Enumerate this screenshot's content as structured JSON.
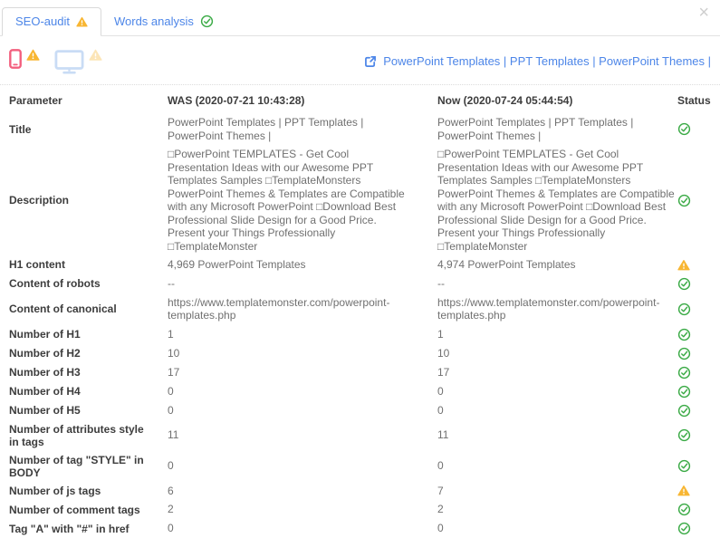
{
  "close_icon": "×",
  "tabs": [
    {
      "label": "SEO-audit",
      "status": "warning",
      "active": true
    },
    {
      "label": "Words analysis",
      "status": "ok",
      "active": false
    }
  ],
  "devices": [
    {
      "name": "mobile",
      "status": "warning"
    },
    {
      "name": "desktop",
      "status": "warning-muted"
    }
  ],
  "page_link": {
    "label": "PowerPoint Templates | PPT Templates | PowerPoint Themes |"
  },
  "colors": {
    "accent_blue": "#4d86e8",
    "ok_green": "#3aaa45",
    "warning_amber": "#f8b633",
    "mobile_pink": "#f35e7d",
    "desktop_light_blue": "#c9dcf5"
  },
  "table": {
    "headers": {
      "parameter": "Parameter",
      "was": "WAS (2020-07-21 10:43:28)",
      "now": "Now (2020-07-24 05:44:54)",
      "status": "Status"
    },
    "rows": [
      {
        "param": "Title",
        "was": "PowerPoint Templates | PPT Templates | PowerPoint Themes |",
        "now": "PowerPoint Templates | PPT Templates | PowerPoint Themes |",
        "status": "ok"
      },
      {
        "param": "Description",
        "was": "□PowerPoint TEMPLATES - Get Cool Presentation Ideas with our Awesome PPT Templates Samples □TemplateMonsters PowerPoint Themes & Templates are Compatible with any Microsoft PowerPoint □Download Best Professional Slide Design for a Good Price. Present your Things Professionally □TemplateMonster",
        "now": "□PowerPoint TEMPLATES - Get Cool Presentation Ideas with our Awesome PPT Templates Samples □TemplateMonsters PowerPoint Themes & Templates are Compatible with any Microsoft PowerPoint □Download Best Professional Slide Design for a Good Price. Present your Things Professionally □TemplateMonster",
        "status": "ok"
      },
      {
        "param": "H1 content",
        "was": "4,969 PowerPoint Templates",
        "now": "4,974 PowerPoint Templates",
        "status": "warning"
      },
      {
        "param": "Content of robots",
        "was": "--",
        "now": "--",
        "status": "ok"
      },
      {
        "param": "Content of canonical",
        "was": "https://www.templatemonster.com/powerpoint-templates.php",
        "now": "https://www.templatemonster.com/powerpoint-templates.php",
        "status": "ok"
      },
      {
        "param": "Number of H1",
        "was": "1",
        "now": "1",
        "status": "ok"
      },
      {
        "param": "Number of H2",
        "was": "10",
        "now": "10",
        "status": "ok"
      },
      {
        "param": "Number of H3",
        "was": "17",
        "now": "17",
        "status": "ok"
      },
      {
        "param": "Number of H4",
        "was": "0",
        "now": "0",
        "status": "ok"
      },
      {
        "param": "Number of H5",
        "was": "0",
        "now": "0",
        "status": "ok"
      },
      {
        "param": "Number of attributes style in tags",
        "was": "11",
        "now": "11",
        "status": "ok"
      },
      {
        "param": "Number of tag \"STYLE\" in BODY",
        "was": "0",
        "now": "0",
        "status": "ok"
      },
      {
        "param": "Number of js tags",
        "was": "6",
        "now": "7",
        "status": "warning"
      },
      {
        "param": "Number of comment tags",
        "was": "2",
        "now": "2",
        "status": "ok"
      },
      {
        "param": "Tag \"A\" with \"#\" in href",
        "was": "0",
        "now": "0",
        "status": "ok"
      }
    ]
  }
}
